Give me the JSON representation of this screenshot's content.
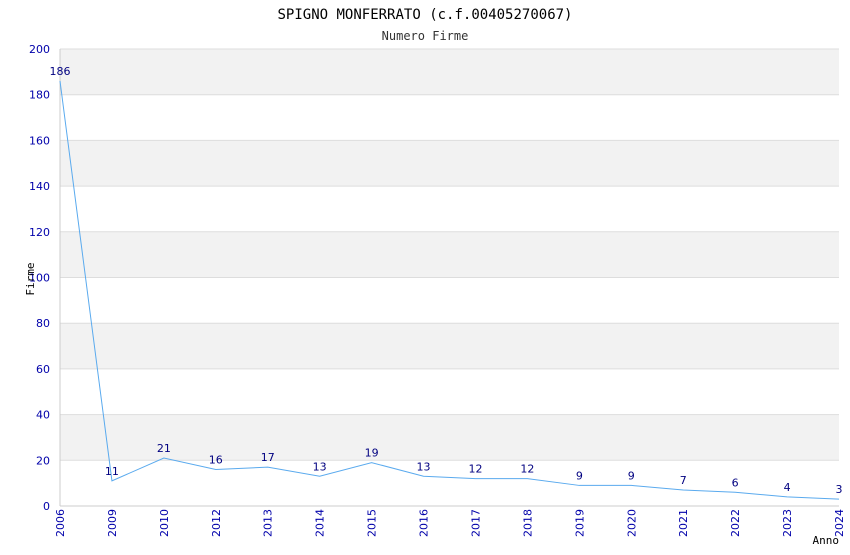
{
  "chart_data": {
    "type": "line",
    "title": "SPIGNO MONFERRATO (c.f.00405270067)",
    "subtitle": "Numero Firme",
    "xlabel": "Anno",
    "ylabel": "Firme",
    "categories": [
      "2006",
      "2009",
      "2010",
      "2012",
      "2013",
      "2014",
      "2015",
      "2016",
      "2017",
      "2018",
      "2019",
      "2020",
      "2021",
      "2022",
      "2023",
      "2024"
    ],
    "series": [
      {
        "values": [
          186,
          11,
          21,
          16,
          17,
          13,
          19,
          13,
          12,
          12,
          9,
          9,
          7,
          6,
          4,
          3
        ]
      }
    ],
    "ylim": [
      0,
      200
    ],
    "yticks": [
      0,
      20,
      40,
      60,
      80,
      100,
      120,
      140,
      160,
      180,
      200
    ],
    "grid": true,
    "legend": "none",
    "colors": {
      "line": "#5aaaee",
      "band": "#f2f2f2",
      "gridline": "#dddddd",
      "tick_text": "#0000aa",
      "data_label": "#000080",
      "axis": "#000000"
    }
  }
}
